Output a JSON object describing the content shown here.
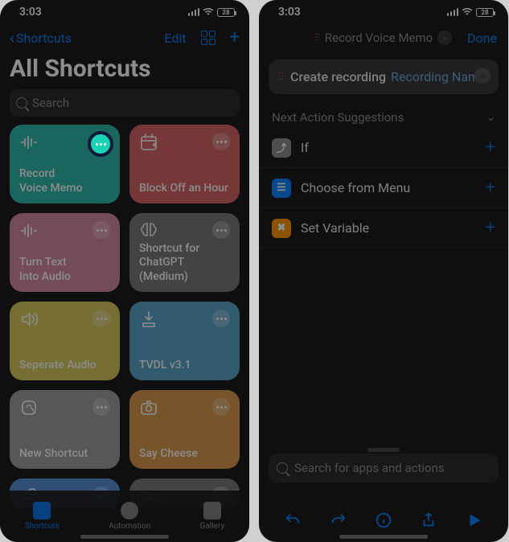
{
  "left": {
    "status": {
      "time": "3:03",
      "battery": "28"
    },
    "nav": {
      "back": "Shortcuts",
      "edit": "Edit"
    },
    "title": "All Shortcuts",
    "search_placeholder": "Search",
    "tiles": [
      {
        "label": "Record\nVoice Memo",
        "color": "teal",
        "icon": "waveform",
        "highlight": true
      },
      {
        "label": "Block Off an Hour",
        "color": "red",
        "icon": "calendar-plus"
      },
      {
        "label": "Turn Text\nInto Audio",
        "color": "pink",
        "icon": "waveform"
      },
      {
        "label": "Shortcut for\nChatGPT\n(Medium)",
        "color": "gray",
        "icon": "brain"
      },
      {
        "label": "Seperate Audio",
        "color": "yellow",
        "icon": "speaker"
      },
      {
        "label": "TVDL v3.1",
        "color": "blue",
        "icon": "download"
      },
      {
        "label": "New Shortcut",
        "color": "lgray",
        "icon": "app"
      },
      {
        "label": "Say Cheese",
        "color": "orange",
        "icon": "camera"
      }
    ],
    "tabs": [
      {
        "label": "Shortcuts",
        "active": true
      },
      {
        "label": "Automation",
        "active": false
      },
      {
        "label": "Gallery",
        "active": false
      }
    ]
  },
  "right": {
    "status": {
      "time": "3:03",
      "battery": "28"
    },
    "nav": {
      "title": "Record Voice Memo",
      "done": "Done"
    },
    "card": {
      "text": "Create recording",
      "placeholder": "Recording Name"
    },
    "section": "Next Action Suggestions",
    "rows": [
      {
        "label": "If",
        "iconClass": "ic-gray",
        "glyph": "⤴"
      },
      {
        "label": "Choose from Menu",
        "iconClass": "ic-blue",
        "glyph": "☰"
      },
      {
        "label": "Set Variable",
        "iconClass": "ic-orange",
        "glyph": "✖"
      }
    ],
    "bottom_search_placeholder": "Search for apps and actions"
  }
}
